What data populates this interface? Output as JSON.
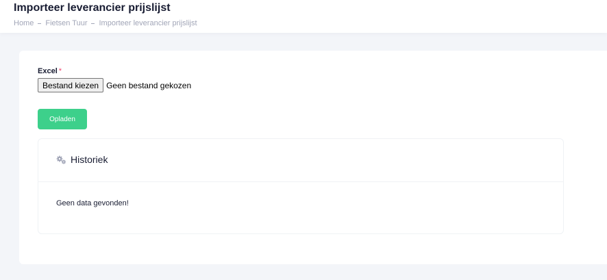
{
  "header": {
    "title": "Importeer leverancier prijslijst",
    "breadcrumb": [
      "Home",
      "Fietsen Tuur",
      "Importeer leverancier prijslijst"
    ]
  },
  "form": {
    "excel_label": "Excel",
    "required_mark": "*",
    "file_button_label": "Bestand kiezen",
    "file_status": "Geen bestand gekozen",
    "upload_label": "Opladen"
  },
  "history": {
    "icon": "gears-icon",
    "title": "Historiek",
    "empty_message": "Geen data gevonden!"
  },
  "colors": {
    "accent": "#3dd08b",
    "required": "#f1416c",
    "muted": "#a1a5b7",
    "background": "#f3f5f9"
  }
}
